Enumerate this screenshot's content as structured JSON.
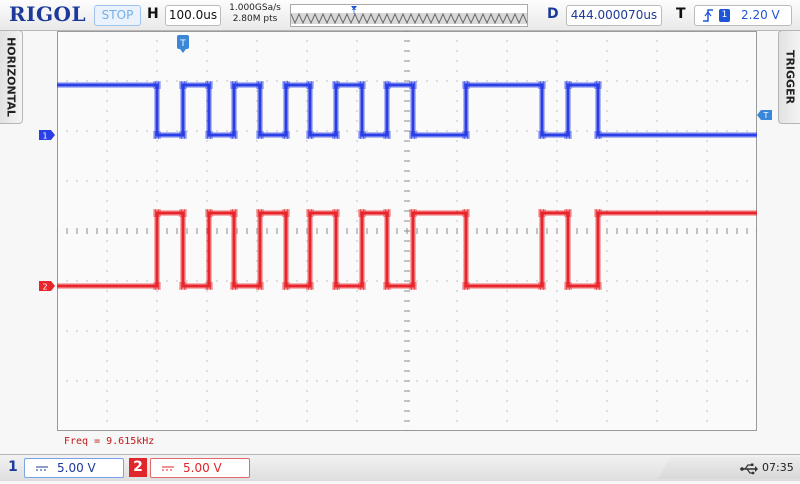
{
  "header": {
    "brand": "RIGOL",
    "run_state": "STOP",
    "horizontal_letter": "H",
    "timebase": "100.0us",
    "sample_rate": "1.000GSa/s",
    "memory_depth": "2.80M pts",
    "trigger_position_marker": "T",
    "delay_letter": "D",
    "delay_value": "444.000070us",
    "trigger_letter": "T",
    "trigger_source": "1",
    "trigger_level": "2.20 V",
    "trigger_edge_icon": "rising-edge-icon"
  },
  "side_tabs": {
    "left_label": "HORIZONTAL",
    "right_label": "TRIGGER"
  },
  "screen_markers": {
    "ch1_marker": "1",
    "ch2_marker": "2",
    "trigger_marker": "T",
    "trigger_level_marker": "T"
  },
  "measurement": {
    "freq_text": "Freq = 9.615kHz"
  },
  "channels": [
    {
      "number": "1",
      "coupling_icon": "dc-coupling-icon",
      "scale": "5.00 V",
      "color": "#2b3fe6"
    },
    {
      "number": "2",
      "coupling_icon": "dc-coupling-icon",
      "scale": "5.00 V",
      "color": "#e8252b"
    }
  ],
  "status": {
    "usb_icon": "usb-icon",
    "time": "07:35"
  },
  "chart_data": {
    "type": "line",
    "x_unit": "us",
    "x_range_us": [
      -456,
      944
    ],
    "series": [
      {
        "channel": "1",
        "color": "#2b3fe6",
        "level_volts": {
          "high": 5,
          "low": 0
        },
        "transitions_us": [
          -256,
          -204,
          -152,
          -102,
          -50,
          2,
          50,
          102,
          154,
          204,
          256,
          362,
          514,
          566,
          626
        ],
        "initial_level": "high"
      },
      {
        "channel": "2",
        "color": "#e8252b",
        "level_volts": {
          "high": 7.3,
          "low": 0
        },
        "transitions_us": [
          -256,
          -204,
          -152,
          -102,
          -50,
          2,
          50,
          102,
          154,
          204,
          256,
          362,
          514,
          566,
          626
        ],
        "initial_level": "low"
      }
    ]
  }
}
